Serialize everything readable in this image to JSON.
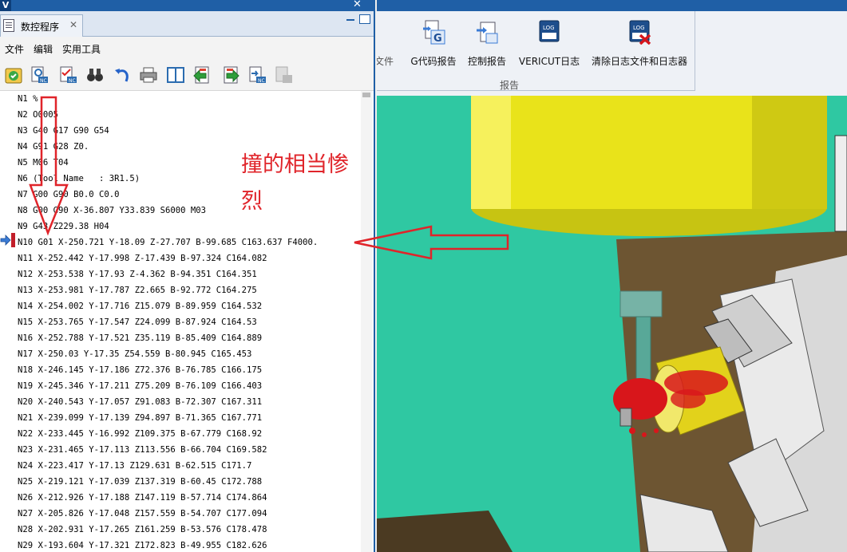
{
  "app": {
    "logo_letter": "V"
  },
  "panel": {
    "tab_title": "数控程序",
    "tab_close": "✕"
  },
  "menu": {
    "items": [
      "文件",
      "编辑",
      "实用工具"
    ]
  },
  "nc_program": {
    "current_line_index": 9,
    "lines": [
      "N1 %",
      "N2 O0005",
      "N3 G40 G17 G90 G54",
      "N4 G91 G28 Z0.",
      "N5 M06 T04",
      "N6 (Tool Name   : 3R1.5)",
      "N7 G00 G90 B0.0 C0.0",
      "N8 G00 G90 X-36.807 Y33.839 S6000 M03",
      "N9 G43 Z229.38 H04",
      "N10 G01 X-250.721 Y-18.09 Z-27.707 B-99.685 C163.637 F4000.",
      "N11 X-252.442 Y-17.998 Z-17.439 B-97.324 C164.082",
      "N12 X-253.538 Y-17.93 Z-4.362 B-94.351 C164.351",
      "N13 X-253.981 Y-17.787 Z2.665 B-92.772 C164.275",
      "N14 X-254.002 Y-17.716 Z15.079 B-89.959 C164.532",
      "N15 X-253.765 Y-17.547 Z24.099 B-87.924 C164.53",
      "N16 X-252.788 Y-17.521 Z35.119 B-85.409 C164.889",
      "N17 X-250.03 Y-17.35 Z54.559 B-80.945 C165.453",
      "N18 X-246.145 Y-17.186 Z72.376 B-76.785 C166.175",
      "N19 X-245.346 Y-17.211 Z75.209 B-76.109 C166.403",
      "N20 X-240.543 Y-17.057 Z91.083 B-72.307 C167.311",
      "N21 X-239.099 Y-17.139 Z94.897 B-71.365 C167.771",
      "N22 X-233.445 Y-16.992 Z109.375 B-67.779 C168.92",
      "N23 X-231.465 Y-17.113 Z113.556 B-66.704 C169.582",
      "N24 X-223.417 Y-17.13 Z129.631 B-62.515 C171.7",
      "N25 X-219.121 Y-17.039 Z137.319 B-60.45 C172.788",
      "N26 X-212.926 Y-17.188 Z147.119 B-57.714 C174.864",
      "N27 X-205.826 Y-17.048 Z157.559 B-54.707 C177.094",
      "N28 X-202.931 Y-17.265 Z161.259 B-53.576 C178.478",
      "N29 X-193.604 Y-17.321 Z172.823 B-49.955 C182.626"
    ]
  },
  "ribbon": {
    "buttons": [
      {
        "label": "文件",
        "icon": "file-icon"
      },
      {
        "label": "G代码报告",
        "icon": "g-code-report-icon"
      },
      {
        "label": "控制报告",
        "icon": "control-report-icon"
      },
      {
        "label": "VERICUT日志",
        "icon": "log-icon"
      },
      {
        "label": "清除日志文件和日志器",
        "icon": "clear-log-icon"
      }
    ],
    "group_label": "报告",
    "log_badge": "LOG",
    "g_badge": "G"
  },
  "annotation": {
    "line1": "撞的相当惨",
    "line2": "烈",
    "color": "#e0242a"
  },
  "colors": {
    "scene_background": "#2fc8a2",
    "spindle": "#e9e31a",
    "titlebar": "#1f5fa6",
    "collision": "#d8161b"
  }
}
